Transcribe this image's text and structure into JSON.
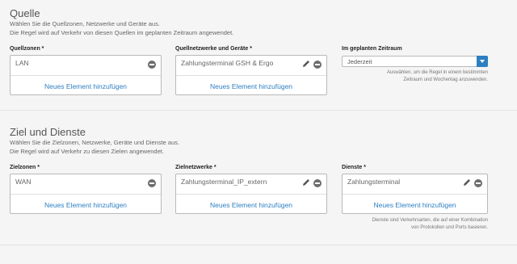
{
  "source": {
    "title": "Quelle",
    "desc_line1": "Wählen Sie die Quellzonen, Netzwerke und Geräte aus.",
    "desc_line2": "Die Regel wird auf Verkehr von diesen Quellen im geplanten Zeitraum angewendet.",
    "zones": {
      "label": "Quellzonen *",
      "item": "LAN",
      "add": "Neues Element hinzufügen"
    },
    "networks": {
      "label": "Quellnetzwerke und Geräte *",
      "item": "Zahlungsterminal GSH & Ergo",
      "add": "Neues Element hinzufügen"
    },
    "schedule": {
      "label": "Im geplanten Zeitraum",
      "value": "Jederzeit",
      "hint_line1": "Auswählen, um die Regel in einem bestimmten",
      "hint_line2": "Zeitraum und Wochentag anzuwenden."
    }
  },
  "destination": {
    "title": "Ziel und Dienste",
    "desc_line1": "Wählen Sie die Zielzonen, Netzwerke, Geräte und Dienste aus.",
    "desc_line2": "Die Regel wird auf Verkehr zu diesen Zielen angewendet.",
    "zones": {
      "label": "Zielzonen *",
      "item": "WAN",
      "add": "Neues Element hinzufügen"
    },
    "networks": {
      "label": "Zielnetzwerke *",
      "item": "Zahlungsterminal_IP_extern",
      "add": "Neues Element hinzufügen"
    },
    "services": {
      "label": "Dienste *",
      "item": "Zahlungsterminal",
      "add": "Neues Element hinzufügen",
      "hint_line1": "Dienste sind Verkehrsarten, die auf einer Kombination",
      "hint_line2": "von Protokollen und Ports basieren."
    }
  },
  "colors": {
    "accent": "#2e7fc1",
    "background": "#f5f5f5"
  },
  "icons": {
    "remove": "minus-circle-icon",
    "edit": "pencil-icon",
    "dropdown": "chevron-down-icon"
  }
}
